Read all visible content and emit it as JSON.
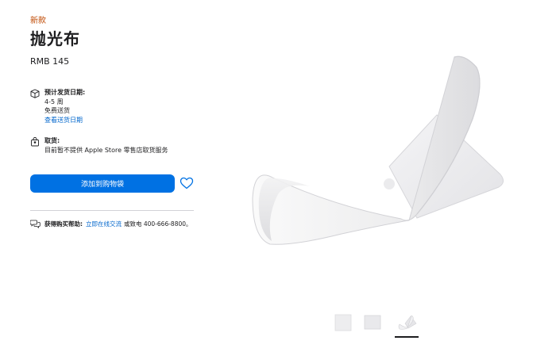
{
  "product": {
    "badge": "新款",
    "title": "抛光布",
    "price": "RMB 145"
  },
  "delivery": {
    "heading": "预计发货日期:",
    "estimate": "4-5 周",
    "shipping": "免费送货",
    "link": "查看送货日期"
  },
  "pickup": {
    "heading": "取货:",
    "status": "目前暂不提供 Apple Store 零售店取货服务"
  },
  "actions": {
    "add_to_bag": "添加到购物袋"
  },
  "help": {
    "label": "获得购买帮助:",
    "chat_link": "立即在线交流",
    "phone_text": "或致电 400-666-8800。"
  },
  "icons": {
    "delivery": "box-icon",
    "pickup": "store-bag-icon",
    "favorite": "heart-icon",
    "help": "chat-bubbles-icon"
  },
  "colors": {
    "accent": "#0071e3",
    "link": "#0066cc",
    "badge": "#bf4800",
    "text": "#1d1d1f"
  }
}
